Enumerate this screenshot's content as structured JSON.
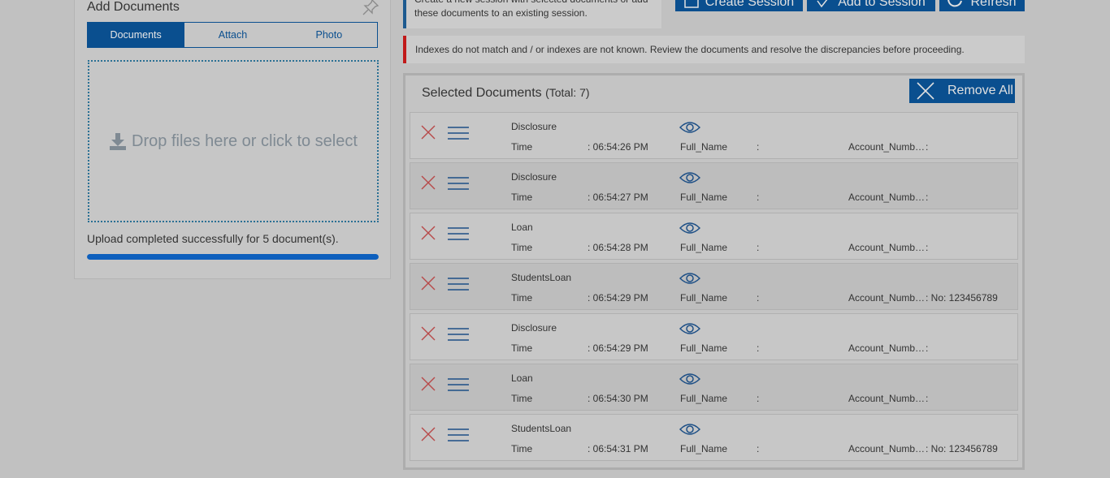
{
  "left_panel": {
    "title": "Add Documents",
    "tabs": [
      "Documents",
      "Attach",
      "Photo"
    ],
    "drop_text": "Drop files here or click to select",
    "upload_message": "Upload completed successfully for 5 document(s).",
    "progress": 1.0
  },
  "info": {
    "line1": "Create a new session with selected documents or add",
    "line2": "these documents to an existing session."
  },
  "buttons": {
    "create_session": "Create Session",
    "add_to_session": "Add to Session",
    "refresh": "Refresh"
  },
  "warning": "Indexes do not match and / or indexes are not known. Review the documents and resolve the discrepancies before proceeding.",
  "selected": {
    "title": "Selected Documents",
    "total": "(Total: 7)",
    "remove_all": "Remove All",
    "time_label": "Time",
    "full_name_label": "Full_Name",
    "account_label": "Account_Numb…",
    "rows": [
      {
        "name": "Disclosure",
        "time": ": 06:54:26 PM",
        "full_name": ":",
        "account": ":"
      },
      {
        "name": "Disclosure",
        "time": ": 06:54:27 PM",
        "full_name": ":",
        "account": ":"
      },
      {
        "name": "Loan",
        "time": ": 06:54:28 PM",
        "full_name": ":",
        "account": ":"
      },
      {
        "name": "StudentsLoan",
        "time": ": 06:54:29 PM",
        "full_name": ":",
        "account": ": No: 123456789"
      },
      {
        "name": "Disclosure",
        "time": ": 06:54:29 PM",
        "full_name": ":",
        "account": ":"
      },
      {
        "name": "Loan",
        "time": ": 06:54:30 PM",
        "full_name": ":",
        "account": ":"
      },
      {
        "name": "StudentsLoan",
        "time": ": 06:54:31 PM",
        "full_name": ":",
        "account": ": No: 123456789"
      }
    ]
  }
}
